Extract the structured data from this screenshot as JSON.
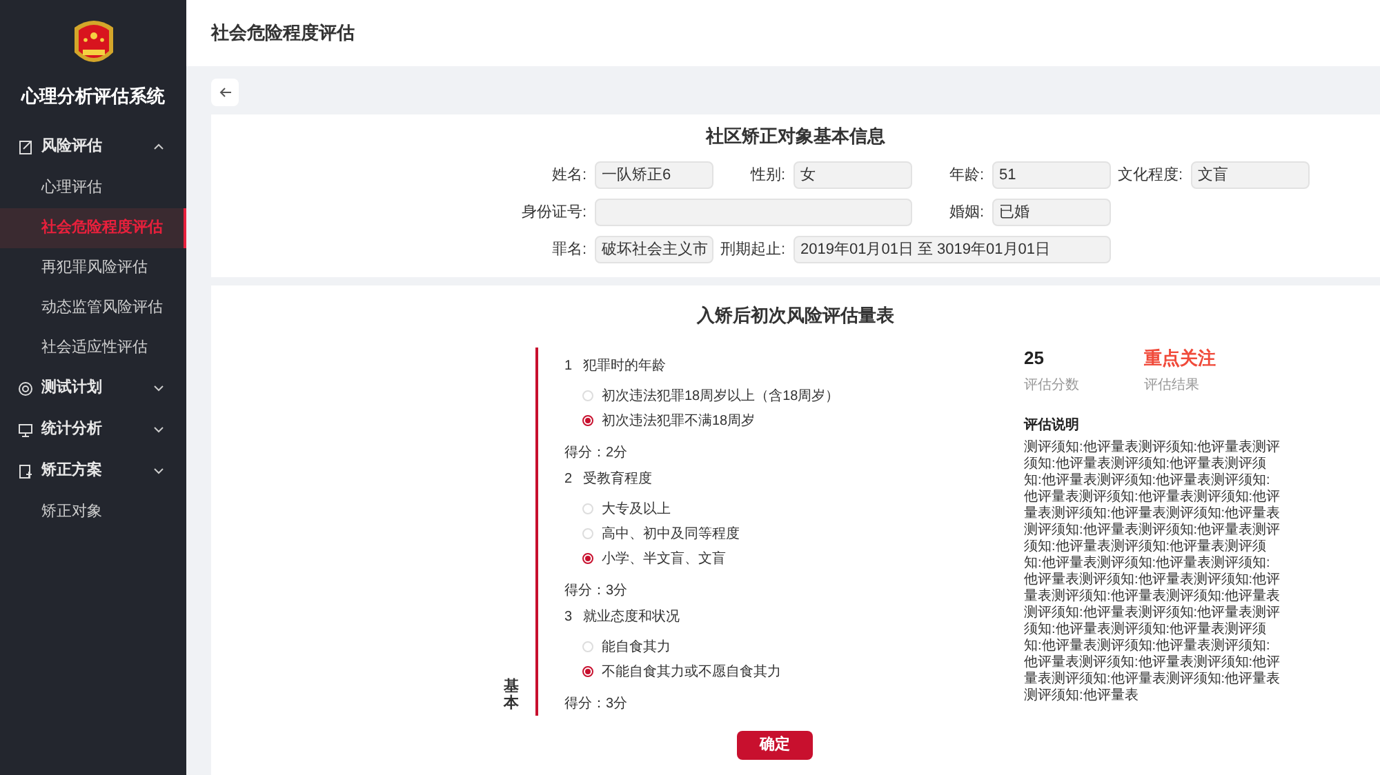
{
  "app": {
    "title": "心理分析评估系统"
  },
  "sidebar": {
    "items": [
      {
        "label": "风险评估",
        "kind": "group",
        "expanded": true,
        "children": [
          {
            "label": "心理评估",
            "selected": false
          },
          {
            "label": "社会危险程度评估",
            "selected": true
          },
          {
            "label": "再犯罪风险评估",
            "selected": false
          },
          {
            "label": "动态监管风险评估",
            "selected": false
          },
          {
            "label": "社会适应性评估",
            "selected": false
          }
        ]
      },
      {
        "label": "测试计划",
        "kind": "group",
        "expanded": false
      },
      {
        "label": "统计分析",
        "kind": "group",
        "expanded": false
      },
      {
        "label": "矫正方案",
        "kind": "group",
        "expanded": false
      },
      {
        "label": "矫正对象",
        "kind": "link"
      }
    ]
  },
  "page": {
    "title": "社会危险程度评估"
  },
  "info": {
    "title": "社区矫正对象基本信息",
    "rows": [
      [
        {
          "label": "姓名:",
          "value": "一队矫正6"
        },
        {
          "label": "性别:",
          "value": "女"
        },
        {
          "label": "年龄:",
          "value": "51"
        },
        {
          "label": "文化程度:",
          "value": "文盲"
        }
      ],
      [
        {
          "label": "身份证号:",
          "kind": "wide"
        },
        {
          "label": "婚姻:",
          "value": "已婚"
        }
      ],
      [
        {
          "label": "罪名:",
          "value": "破坏社会主义市"
        },
        {
          "label": "刑期起止:",
          "value": "2019年01月01日 至 3019年01月01日",
          "kind": "wide"
        }
      ]
    ]
  },
  "scale": {
    "title": "入矫后初次风险评估量表",
    "section_label": "基本",
    "questions": [
      {
        "number": "1",
        "title": "犯罪时的年龄",
        "options": [
          {
            "label": "初次违法犯罪18周岁以上（含18周岁）",
            "selected": false
          },
          {
            "label": "初次违法犯罪不满18周岁",
            "selected": true
          }
        ],
        "score": "得分：2分"
      },
      {
        "number": "2",
        "title": "受教育程度",
        "options": [
          {
            "label": "大专及以上",
            "selected": false
          },
          {
            "label": "高中、初中及同等程度",
            "selected": false
          },
          {
            "label": "小学、半文盲、文盲",
            "selected": true
          }
        ],
        "score": "得分：3分"
      },
      {
        "number": "3",
        "title": "就业态度和状况",
        "options": [
          {
            "label": "能自食其力",
            "selected": false
          },
          {
            "label": "不能自食其力或不愿自食其力",
            "selected": true
          }
        ],
        "score": "得分：3分"
      }
    ],
    "result": {
      "score": "25",
      "score_label": "评估分数",
      "verdict": "重点关注",
      "verdict_label": "评估结果",
      "notes_title": "评估说明",
      "notes": "测评须知:他评量表测评须知:他评量表测评须知:他评量表测评须知:他评量表测评须知:他评量表测评须知:他评量表测评须知:他评量表测评须知:他评量表测评须知:他评量表测评须知:他评量表测评须知:他评量表测评须知:他评量表测评须知:他评量表测评须知:他评量表测评须知:他评量表测评须知:他评量表测评须知:他评量表测评须知:他评量表测评须知:他评量表测评须知:他评量表测评须知:他评量表测评须知:他评量表测评须知:他评量表测评须知:他评量表测评须知:他评量表测评须知:他评量表测评须知:他评量表测评须知:他评量表测评须知:他评量表测评须知:他评量表测评须知:他评量表测评须知:他评量表测评须知:他评量表测评须知:他评量表"
    }
  },
  "confirm_button": "确定"
}
